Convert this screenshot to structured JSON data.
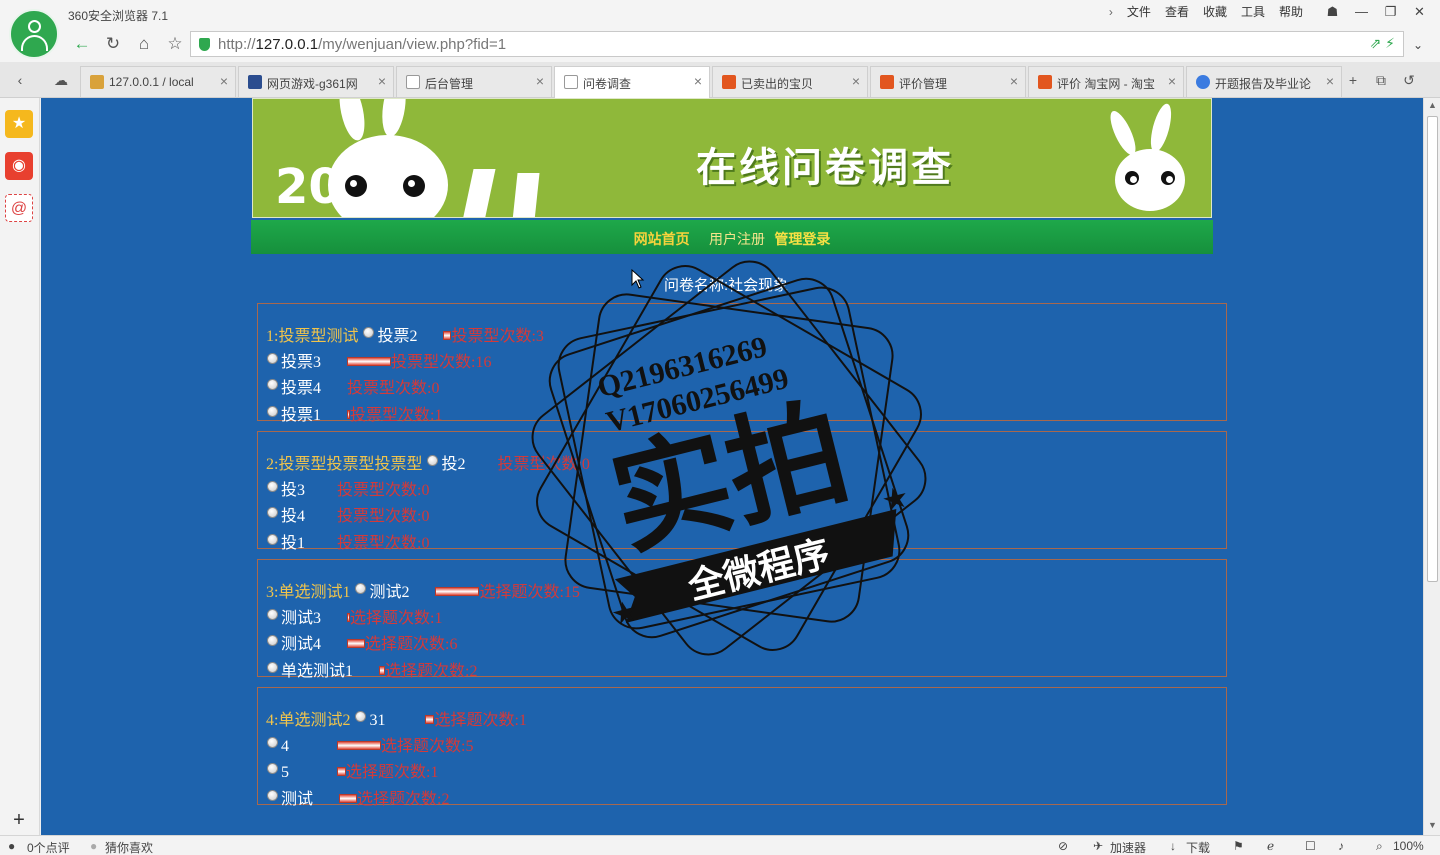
{
  "browser": {
    "app_title": "360安全浏览器 7.1",
    "menu": [
      "文件",
      "查看",
      "收藏",
      "工具",
      "帮助"
    ],
    "url_prefix": "http://",
    "url_host": "127.0.0.1",
    "url_path": "/my/wenjuan/view.php?fid=1"
  },
  "tabs": [
    {
      "label": "127.0.0.1 / local",
      "color": "#d9a23b"
    },
    {
      "label": "网页游戏-g361网",
      "color": "#2b4d8f"
    },
    {
      "label": "后台管理",
      "color": "#cccccc"
    },
    {
      "label": "问卷调查",
      "color": "#cccccc"
    },
    {
      "label": "已卖出的宝贝",
      "color": "#e2561f"
    },
    {
      "label": "评价管理",
      "color": "#e2561f"
    },
    {
      "label": "评价 淘宝网 - 淘宝",
      "color": "#e2561f"
    },
    {
      "label": "开题报告及毕业论",
      "color": "#3b7be0"
    }
  ],
  "site": {
    "banner_title": "在线问卷调查",
    "banner_year": "2011",
    "nav": {
      "home": "网站首页",
      "register": "用户注册",
      "admin": "管理登录"
    },
    "survey_title": "问卷名称:社会现象"
  },
  "questions": [
    {
      "title": "1:投票型测试",
      "options": [
        {
          "label": "投票2",
          "count_text": "投票型次数:3",
          "bar": 0.19
        },
        {
          "label": "投票3",
          "count_text": "投票型次数:16",
          "bar": 1.0
        },
        {
          "label": "投票4",
          "count_text": "投票型次数:0",
          "bar": 0
        },
        {
          "label": "投票1",
          "count_text": "投票型次数:1",
          "bar": 0.06
        }
      ]
    },
    {
      "title": "2:投票型投票型投票型",
      "options": [
        {
          "label": "投2",
          "count_text": "投票型次数:0",
          "bar": 0
        },
        {
          "label": "投3",
          "count_text": "投票型次数:0",
          "bar": 0
        },
        {
          "label": "投4",
          "count_text": "投票型次数:0",
          "bar": 0
        },
        {
          "label": "投1",
          "count_text": "投票型次数:0",
          "bar": 0
        }
      ]
    },
    {
      "title": "3:单选测试1",
      "options": [
        {
          "label": "测试2",
          "count_text": "选择题次数:15",
          "bar": 1.0
        },
        {
          "label": "测试3",
          "count_text": "选择题次数:1",
          "bar": 0.07
        },
        {
          "label": "测试4",
          "count_text": "选择题次数:6",
          "bar": 0.4
        },
        {
          "label": "单选测试1",
          "count_text": "选择题次数:2",
          "bar": 0.13
        }
      ]
    },
    {
      "title": "4:单选测试2",
      "options": [
        {
          "label": "31",
          "count_text": "选择题次数:1",
          "bar": 0.2
        },
        {
          "label": "4",
          "count_text": "选择题次数:5",
          "bar": 1.0
        },
        {
          "label": "5",
          "count_text": "选择题次数:1",
          "bar": 0.2
        },
        {
          "label": "测试",
          "count_text": "选择题次数:2",
          "bar": 0.4
        }
      ]
    }
  ],
  "watermark": {
    "line1": "Q2196316269",
    "line2": "V17060256499",
    "big": "实拍",
    "ribbon": "全微程序"
  },
  "status": {
    "comments": "0个点评",
    "guess": "猜你喜欢",
    "accelerator": "加速器",
    "download": "下载",
    "zoom": "100%"
  }
}
